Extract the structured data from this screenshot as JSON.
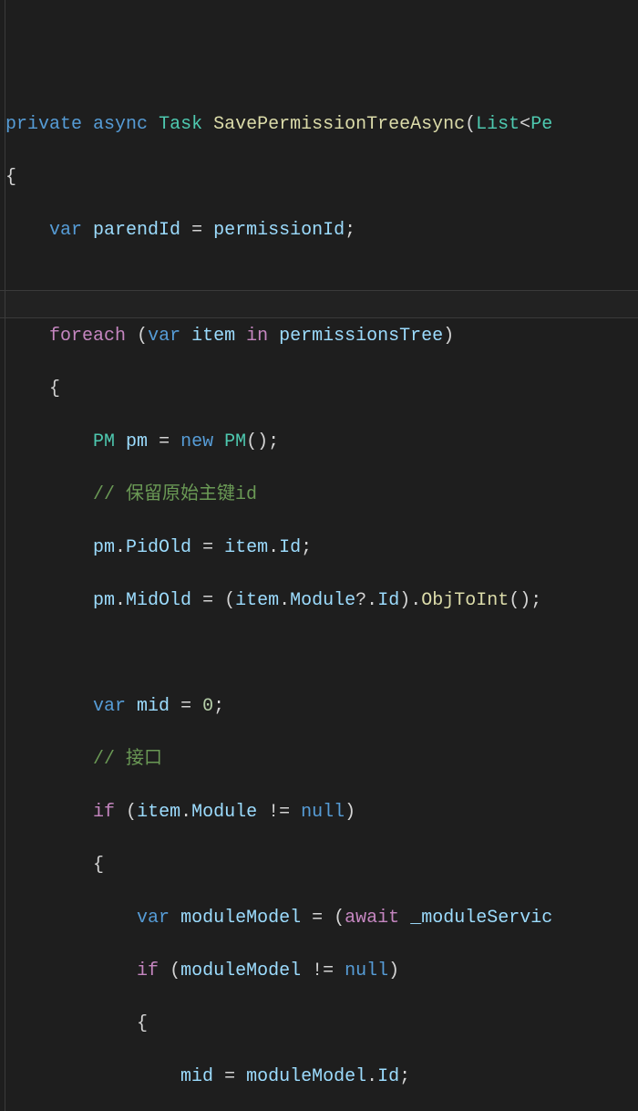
{
  "code": {
    "l1": {
      "a": "private",
      "b": "async",
      "c": "Task",
      "d": "SavePermissionTreeAsync",
      "e": "List",
      "f": "Pe"
    },
    "l2": {
      "brace": "{"
    },
    "l3": {
      "a": "var",
      "b": "parendId",
      "c": "permissionId"
    },
    "l5": {
      "a": "foreach",
      "b": "var",
      "c": "item",
      "d": "in",
      "e": "permissionsTree"
    },
    "l6": {
      "brace": "{"
    },
    "l7": {
      "a": "PM",
      "b": "pm",
      "c": "new",
      "d": "PM"
    },
    "l8": {
      "cmt": "// 保留原始主键id"
    },
    "l9": {
      "a": "pm",
      "b": "PidOld",
      "c": "item",
      "d": "Id"
    },
    "l10": {
      "a": "pm",
      "b": "MidOld",
      "c": "item",
      "d": "Module",
      "e": "Id",
      "f": "ObjToInt"
    },
    "l12": {
      "a": "var",
      "b": "mid",
      "c": "0"
    },
    "l13": {
      "cmt": "// 接口"
    },
    "l14": {
      "a": "if",
      "b": "item",
      "c": "Module",
      "d": "null"
    },
    "l15": {
      "brace": "{"
    },
    "l16": {
      "a": "var",
      "b": "moduleModel",
      "c": "await",
      "d": "_moduleServic"
    },
    "l17": {
      "a": "if",
      "b": "moduleModel",
      "c": "null"
    },
    "l18": {
      "brace": "{"
    },
    "l19": {
      "a": "mid",
      "b": "moduleModel",
      "c": "Id"
    }
  }
}
